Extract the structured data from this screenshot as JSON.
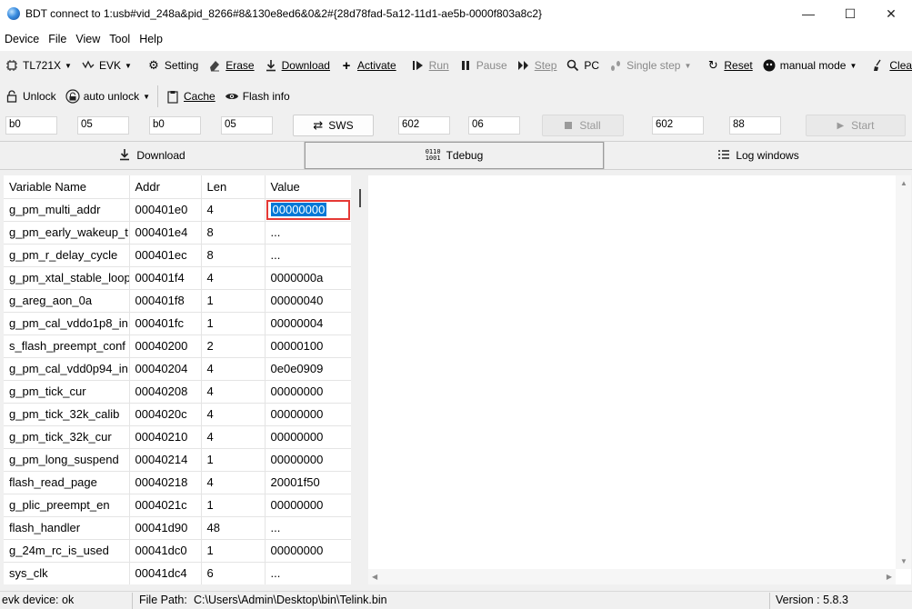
{
  "window": {
    "title": "BDT connect to 1:usb#vid_248a&pid_8266#8&130e8ed6&0&2#{28d78fad-5a12-11d1-ae5b-0000f803a8c2}",
    "minimize": "—",
    "maximize": "☐",
    "close": "✕"
  },
  "menu": [
    "Device",
    "File",
    "View",
    "Tool",
    "Help"
  ],
  "toolbar1": {
    "chip": "TL721X",
    "board": "EVK",
    "setting": "Setting",
    "erase": "Erase",
    "download": "Download",
    "activate": "Activate",
    "run": "Run",
    "pause": "Pause",
    "step": "Step",
    "pc": "PC",
    "single_step": "Single step",
    "reset": "Reset",
    "mode": "manual mode",
    "clear": "Clear"
  },
  "toolbar2": {
    "unlock": "Unlock",
    "auto_unlock": "auto unlock",
    "cache": "Cache",
    "flash_info": "Flash info"
  },
  "params": {
    "f1": "b0",
    "f2": "05",
    "f3": "b0",
    "f4": "05",
    "sws": "SWS",
    "f5": "602",
    "f6": "06",
    "stall": "Stall",
    "f7": "602",
    "f8": "88",
    "start": "Start"
  },
  "tabs": {
    "download": "Download",
    "tdebug": "Tdebug",
    "log": "Log windows"
  },
  "table": {
    "headers": [
      "Variable Name",
      "Addr",
      "Len",
      "Value"
    ],
    "rows": [
      [
        "g_pm_multi_addr",
        "000401e0",
        "4",
        "00000000"
      ],
      [
        "g_pm_early_wakeup_t",
        "000401e4",
        "8",
        "..."
      ],
      [
        "g_pm_r_delay_cycle",
        "000401ec",
        "8",
        "..."
      ],
      [
        "g_pm_xtal_stable_loop",
        "000401f4",
        "4",
        "0000000a"
      ],
      [
        "g_areg_aon_0a",
        "000401f8",
        "1",
        "00000040"
      ],
      [
        "g_pm_cal_vddo1p8_in",
        "000401fc",
        "1",
        "00000004"
      ],
      [
        "s_flash_preempt_conf",
        "00040200",
        "2",
        "00000100"
      ],
      [
        "g_pm_cal_vdd0p94_in",
        "00040204",
        "4",
        "0e0e0909"
      ],
      [
        "g_pm_tick_cur",
        "00040208",
        "4",
        "00000000"
      ],
      [
        "g_pm_tick_32k_calib",
        "0004020c",
        "4",
        "00000000"
      ],
      [
        "g_pm_tick_32k_cur",
        "00040210",
        "4",
        "00000000"
      ],
      [
        "g_pm_long_suspend",
        "00040214",
        "1",
        "00000000"
      ],
      [
        "flash_read_page",
        "00040218",
        "4",
        "20001f50"
      ],
      [
        "g_plic_preempt_en",
        "0004021c",
        "1",
        "00000000"
      ],
      [
        "flash_handler",
        "00041d90",
        "48",
        "..."
      ],
      [
        "g_24m_rc_is_used",
        "00041dc0",
        "1",
        "00000000"
      ],
      [
        "sys_clk",
        "00041dc4",
        "6",
        "..."
      ]
    ]
  },
  "status": {
    "device": "evk device: ok",
    "file_path_label": "File Path:",
    "file_path": "C:\\Users\\Admin\\Desktop\\bin\\Telink.bin",
    "version": "Version : 5.8.3"
  }
}
